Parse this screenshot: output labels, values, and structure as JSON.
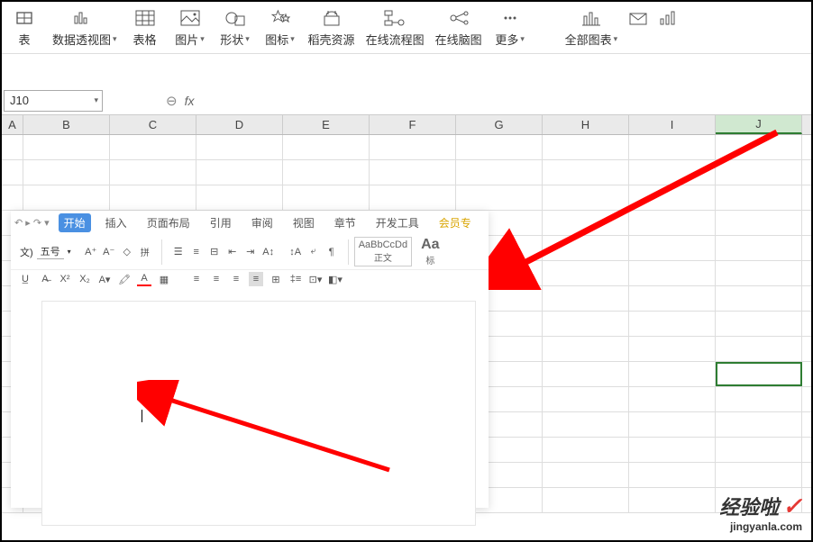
{
  "toolbar": {
    "items": [
      {
        "label": "表",
        "icon": "table"
      },
      {
        "label": "数据透视图",
        "icon": "pivot",
        "dropdown": true
      },
      {
        "label": "表格",
        "icon": "grid"
      },
      {
        "label": "图片",
        "icon": "picture",
        "dropdown": true
      },
      {
        "label": "形状",
        "icon": "shapes",
        "dropdown": true
      },
      {
        "label": "图标",
        "icon": "icons",
        "dropdown": true
      },
      {
        "label": "稻壳资源",
        "icon": "resource"
      },
      {
        "label": "在线流程图",
        "icon": "flowchart"
      },
      {
        "label": "在线脑图",
        "icon": "mindmap"
      },
      {
        "label": "更多",
        "icon": "more",
        "dropdown": true
      },
      {
        "label": "全部图表",
        "icon": "chart",
        "dropdown": true
      }
    ]
  },
  "formula_bar": {
    "cell_ref": "J10",
    "fx": "fx"
  },
  "columns": [
    "A",
    "B",
    "C",
    "D",
    "E",
    "F",
    "G",
    "H",
    "I",
    "J"
  ],
  "selected_col": "J",
  "overlay": {
    "tabs": [
      "开始",
      "插入",
      "页面布局",
      "引用",
      "审阅",
      "视图",
      "章节",
      "开发工具",
      "会员专"
    ],
    "active_tab": "开始",
    "font_size": "五号",
    "styles": [
      {
        "preview": "AaBbCcDd",
        "name": "正文"
      },
      {
        "preview": "Aa",
        "name": "标"
      }
    ],
    "redo_label": "↻",
    "format_label": "文)"
  },
  "watermark": {
    "main": "经验啦",
    "sub": "jingyanla.com"
  }
}
